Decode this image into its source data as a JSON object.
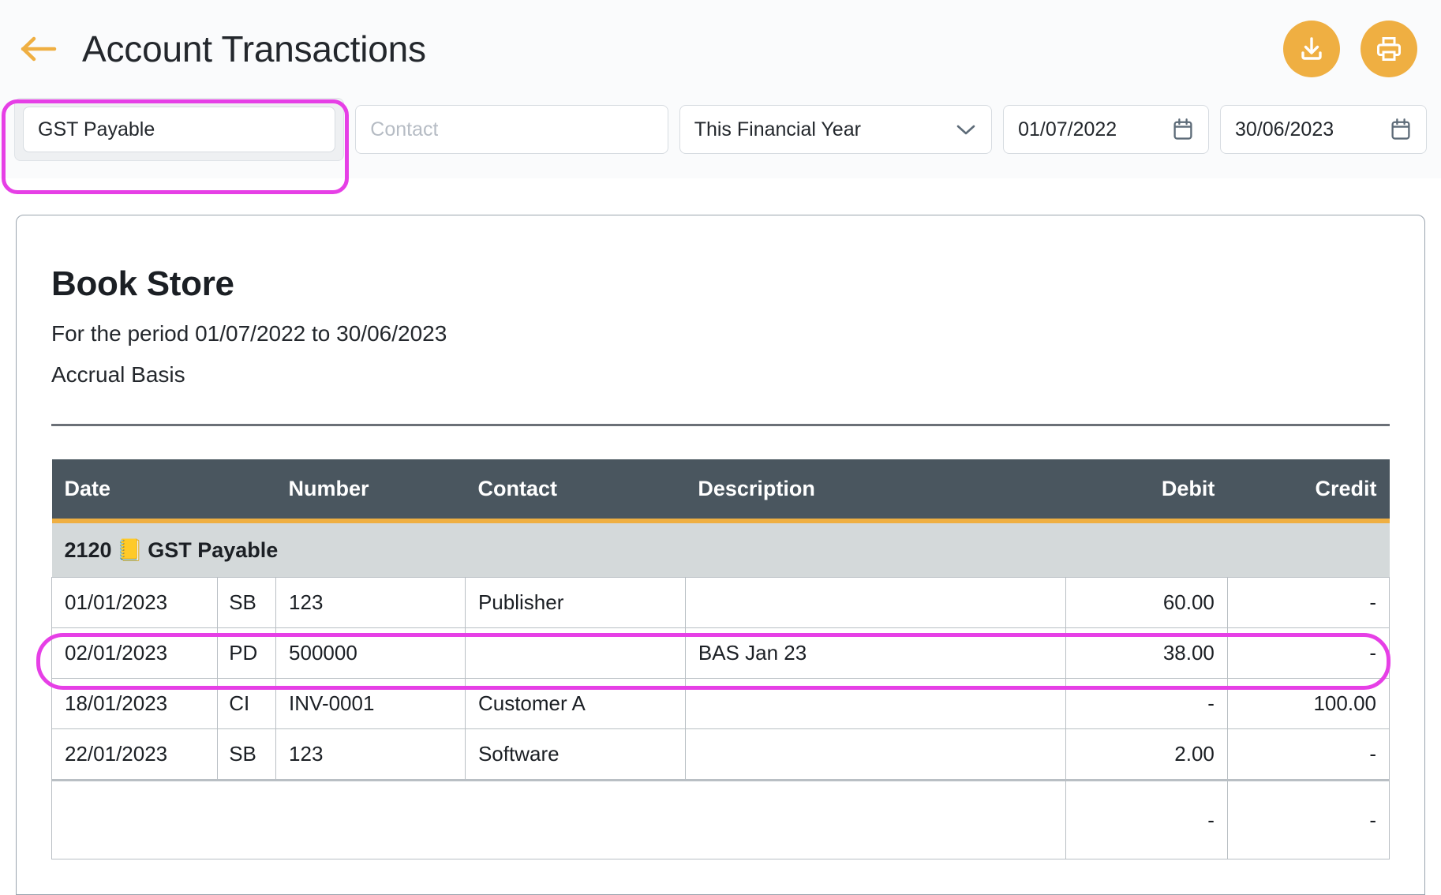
{
  "header": {
    "title": "Account Transactions",
    "back_icon": "arrow-left-icon",
    "download_icon": "download-icon",
    "print_icon": "print-icon"
  },
  "filters": {
    "account": {
      "value": "GST Payable",
      "placeholder": "Account"
    },
    "contact": {
      "value": "",
      "placeholder": "Contact"
    },
    "period": {
      "value": "This Financial Year",
      "chevron_icon": "chevron-down-icon"
    },
    "date_from": {
      "value": "01/07/2022",
      "calendar_icon": "calendar-icon"
    },
    "date_to": {
      "value": "30/06/2023",
      "calendar_icon": "calendar-icon"
    }
  },
  "report": {
    "company": "Book Store",
    "period_line": "For the period 01/07/2022 to 30/06/2023",
    "basis_line": "Accrual Basis"
  },
  "table": {
    "columns": [
      "Date",
      "Number",
      "Contact",
      "Description",
      "Debit",
      "Credit"
    ],
    "group": {
      "code": "2120",
      "icon": "📒",
      "name": "GST Payable"
    },
    "rows": [
      {
        "date": "01/01/2023",
        "type": "SB",
        "number": "123",
        "contact": "Publisher",
        "description": "",
        "debit": "60.00",
        "credit": "-"
      },
      {
        "date": "02/01/2023",
        "type": "PD",
        "number": "500000",
        "contact": "",
        "description": "BAS Jan 23",
        "debit": "38.00",
        "credit": "-"
      },
      {
        "date": "18/01/2023",
        "type": "CI",
        "number": "INV-0001",
        "contact": "Customer A",
        "description": "",
        "debit": "-",
        "credit": "100.00"
      },
      {
        "date": "22/01/2023",
        "type": "SB",
        "number": "123",
        "contact": "Software",
        "description": "",
        "debit": "2.00",
        "credit": "-"
      }
    ],
    "total": {
      "label": "",
      "debit": "-",
      "credit": "-"
    }
  },
  "colors": {
    "accent_orange": "#efaf42",
    "header_dark": "#4a565f",
    "group_grey": "#d4d9da",
    "highlight_magenta": "#e63fe6"
  }
}
